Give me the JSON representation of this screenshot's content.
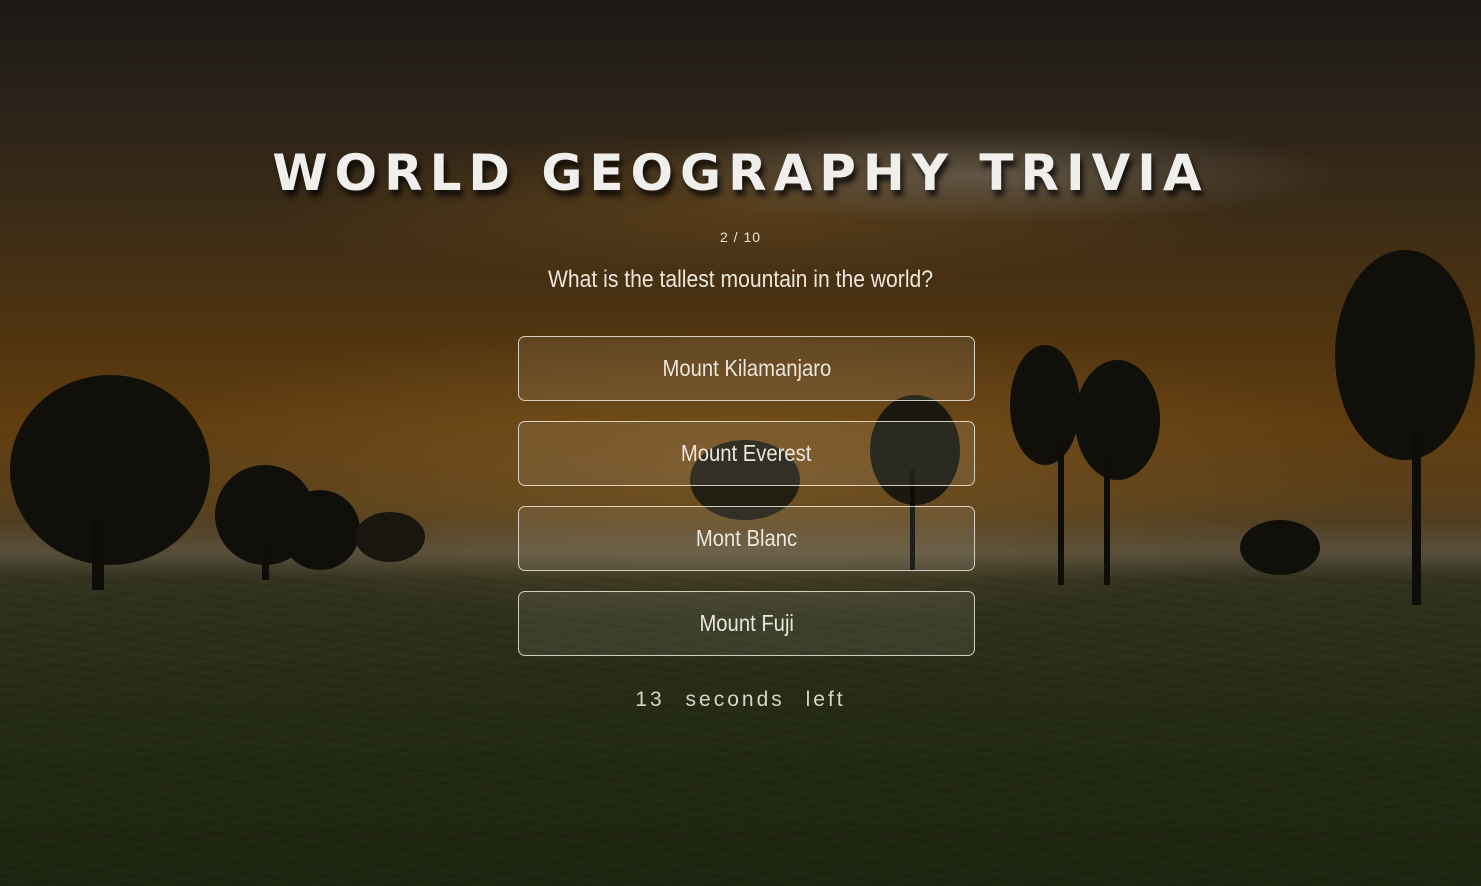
{
  "quiz": {
    "title": "WORLD GEOGRAPHY TRIVIA",
    "progress": "2 / 10",
    "question": "What is the tallest mountain in the world?",
    "answers": [
      {
        "label": "Mount Kilamanjaro"
      },
      {
        "label": "Mount Everest"
      },
      {
        "label": "Mont Blanc"
      },
      {
        "label": "Mount Fuji"
      }
    ],
    "timer": "13 seconds left"
  },
  "colors": {
    "text": "#f1efec",
    "answer_border": "#ebe6dc",
    "overlay": "rgba(0,0,0,0.42)"
  }
}
